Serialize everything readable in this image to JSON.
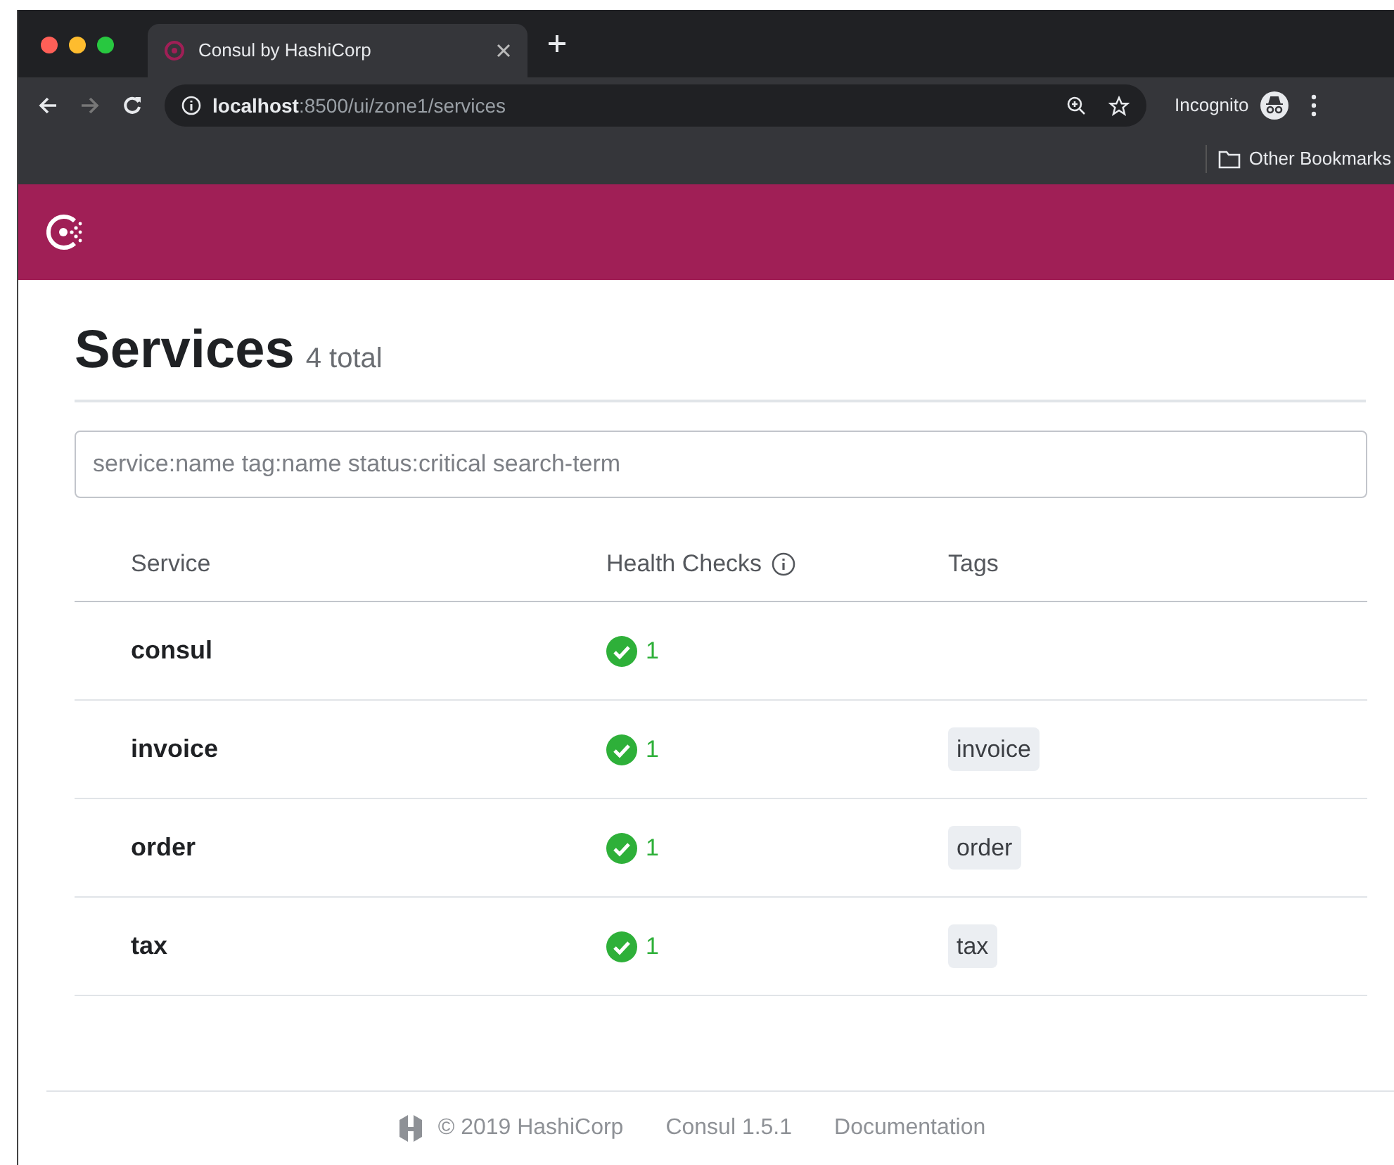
{
  "browser": {
    "tab_title": "Consul by HashiCorp",
    "url": "**localhost**:8500/ui/zone1/services",
    "profile": "Incognito",
    "bookmarks": [
      "Other Bookmarks"
    ]
  },
  "page": {
    "title": "Services",
    "count": "4 total",
    "search": {
      "placeholder": "service:name tag:name status:critical search-term"
    },
    "table": {
      "columns": [
        "Service",
        "Health Checks",
        "Tags"
      ],
      "rows": [
        {
          "service": "consul",
          "passing": "1",
          "tags": []
        },
        {
          "service": "invoice",
          "passing": "1",
          "tags": [
            "invoice"
          ]
        },
        {
          "service": "order",
          "passing": "1",
          "tags": [
            "order"
          ]
        },
        {
          "service": "tax",
          "passing": "1",
          "tags": [
            "tax"
          ]
        }
      ]
    }
  },
  "footer": {
    "links": [
      "© 2019 HashiCorp",
      "Consul 1.5.1",
      "Documentation"
    ]
  }
}
